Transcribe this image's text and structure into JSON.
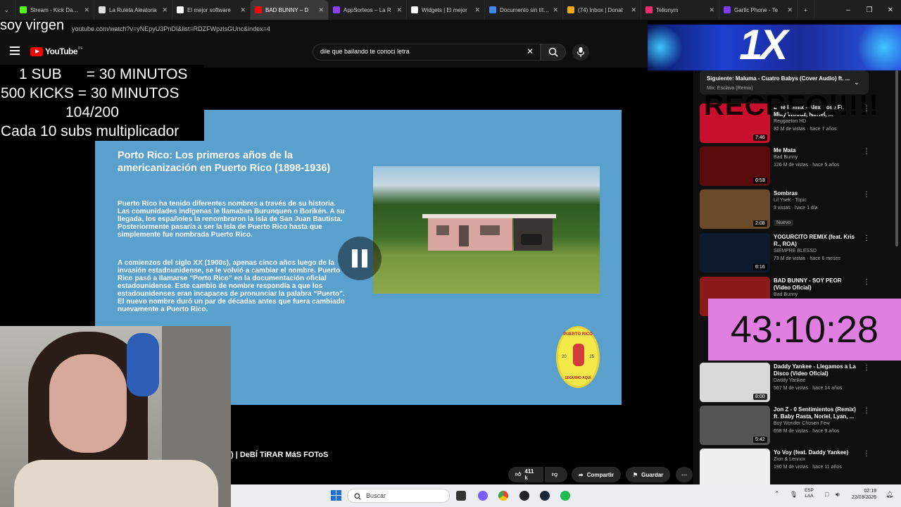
{
  "browser": {
    "tabs": [
      {
        "title": "Stream - Kick Dashboard",
        "color": "#53fc18"
      },
      {
        "title": "La Ruleta Aleatoria",
        "color": "#e0e0e0"
      },
      {
        "title": "El mejor software",
        "color": "#ffffff"
      },
      {
        "title": "BAD BUNNY – D",
        "color": "#ff0000",
        "active": true
      },
      {
        "title": "AppSorteos – La R",
        "color": "#8a3ffc"
      },
      {
        "title": "Widgets | El mejor",
        "color": "#ffffff"
      },
      {
        "title": "Documento sin título",
        "color": "#4285f4"
      },
      {
        "title": "(74) Inbox | Donat",
        "color": "#f4a81d"
      },
      {
        "title": "Tellonym",
        "color": "#ff2a6d"
      },
      {
        "title": "Gartic Phone - Te",
        "color": "#7a3cff"
      }
    ],
    "new_tab": "+",
    "url": "youtube.com/watch?v=yNEpyU3PnDI&list=RDZFWpzlsGUnc&index=4"
  },
  "overlay": {
    "soy_virgen": "soy virgen",
    "counter_lines": [
      "1 SUB      = 30 MINUTOS",
      "500 KICKS = 30 MINUTOS",
      "104/200",
      "Cada 10 subs multiplicador"
    ],
    "recreo": "RECREO!!!!!",
    "timer": "43:10:28",
    "banner": "1X"
  },
  "youtube": {
    "logo": "YouTube",
    "country": "PE",
    "search_query": "dile que bailando te conoci letra",
    "video": {
      "title_line": ") | DeBÍ TiRAR MáS FOToS",
      "heading": "Porto Rico: Los primeros años de la americanización en Puerto Rico (1898-1936)",
      "para1": "Puerto Rico ha tenido diferentes nombres a través de su historia. Las comunidades indígenas le llamaban Burunquen o Borikén. A su llegada, los españoles la renombraron la Isla de San Juan Bautista. Posteriormente pasaría a ser la Isla de Puerto Rico hasta que simplemente fue nombrada Puerto Rico.",
      "para2": "A comienzos del siglo XX (1900s), apenas cinco años luego de la invasión estadounidense, se le volvió a cambiar el nombre. Puerto Rico pasó a llamarse “Porto Rico” en la documentación oficial estadounidense. Este cambio de nombre respondía a que los estadounidenses eran incapaces de pronunciar la palabra “Puerto”. El nuevo nombre duró un par de décadas antes que fuera cambiado nuevamente a Puerto Rico.",
      "badge_top": "PUERTO RICO",
      "badge_year_left": "20",
      "badge_year_right": "25",
      "badge_bottom": "SEGUIMO AQUÍ"
    },
    "actions": {
      "likes": "411 k",
      "share": "Compartir",
      "save": "Guardar",
      "more": "⋯"
    },
    "up_next": {
      "title": "Siguiente: Maluma - Cuatro Babys (Cover Audio) ft. ...",
      "subtitle": "Mix: Esclava (Remix)"
    },
    "sidebar": [
      {
        "title": "Dale Remix - Alex Rose Ft. Miky Woodz, Noriel, ...",
        "channel": "Reggaeton HD",
        "meta": "32 M de vistas · hace 7 años",
        "duration": "7:46",
        "thumb": "#c8102e"
      },
      {
        "title": "Me Mata",
        "channel": "Bad Bunny",
        "meta": "126 M de vistas · hace 5 años",
        "duration": "6:53",
        "thumb": "#5a0a0a"
      },
      {
        "title": "Sombras",
        "channel": "Lil Ysek - Topic",
        "meta": "3 vistas · hace 1 día",
        "duration": "2:08",
        "thumb": "#6b4a2a",
        "badge": "Nuevo"
      },
      {
        "title": "YOGURCITO REMIX (feat. Kris R., ROA)",
        "channel": "SIEMPRE BLESSD",
        "meta": "73 M de vistas · hace 6 meses",
        "duration": "6:16",
        "thumb": "#0d1a2c"
      },
      {
        "title": "BAD BUNNY - SOY PEOR (Video Oficial)",
        "channel": "Bad Bunny",
        "meta": "",
        "duration": "",
        "thumb": "#8a1a1a"
      },
      {
        "title": "Daddy Yankee - Llegamos a La Disco (Video Oficial)",
        "channel": "Daddy Yankee",
        "meta": "567 M de vistas · hace 14 años",
        "duration": "8:00",
        "thumb": "#d9d9d9"
      },
      {
        "title": "Jon Z - 0 Sentimientos (Remix) ft. Baby Rasta, Noriel, Lyan, ...",
        "channel": "Boy Wonder Chosen Few",
        "meta": "658 M de vistas · hace 9 años",
        "duration": "5:42",
        "thumb": "#555555"
      },
      {
        "title": "Yo Voy (feat. Daddy Yankee)",
        "channel": "Zion & Lennox",
        "meta": "190 M de vistas · hace 11 años",
        "duration": "",
        "thumb": "#f0f0f0"
      }
    ]
  },
  "taskbar": {
    "search": "Buscar",
    "lang": "ESP",
    "lang2": "LAA",
    "time": "02:19",
    "date": "22/03/2026"
  }
}
